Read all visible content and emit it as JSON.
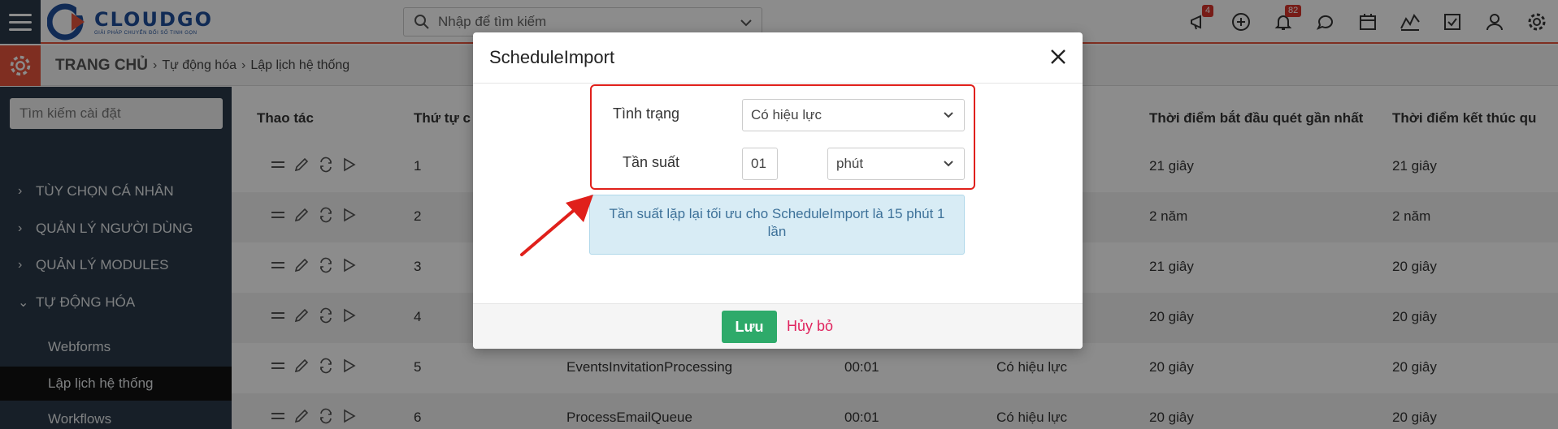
{
  "app": {
    "logo_name": "CLOUDGO",
    "logo_tagline": "GIẢI PHÁP CHUYỂN ĐỔI SỐ TINH GỌN",
    "search_placeholder": "Nhập để tìm kiếm",
    "badges": {
      "announce": "4",
      "notifications": "82"
    }
  },
  "breadcrumb": {
    "home": "TRANG CHỦ",
    "level1": "Tự động hóa",
    "level2": "Lập lịch hệ thống"
  },
  "sidebar": {
    "search_placeholder": "Tìm kiếm cài đặt",
    "groups": [
      {
        "label": "TÙY CHỌN CÁ NHÂN"
      },
      {
        "label": "QUẢN LÝ NGƯỜI DÙNG"
      },
      {
        "label": "QUẢN LÝ MODULES"
      },
      {
        "label": "TỰ ĐỘNG HÓA"
      }
    ],
    "subitems": [
      {
        "label": "Webforms"
      },
      {
        "label": "Lập lịch hệ thống"
      },
      {
        "label": "Workflows"
      }
    ]
  },
  "table": {
    "headers": {
      "actions": "Thao tác",
      "order": "Thứ tự c",
      "start": "Thời điểm bắt đầu quét gần nhất",
      "end": "Thời điểm kết thúc qu"
    },
    "rows": [
      {
        "order": "1",
        "name": "",
        "freq": "",
        "status": "",
        "start": "21 giây",
        "end": "21 giây"
      },
      {
        "order": "2",
        "name": "",
        "freq": "",
        "status": "",
        "start": "2 năm",
        "end": "2 năm"
      },
      {
        "order": "3",
        "name": "",
        "freq": "",
        "status": "",
        "start": "21 giây",
        "end": "20 giây"
      },
      {
        "order": "4",
        "name": "",
        "freq": "",
        "status": "",
        "start": "20 giây",
        "end": "20 giây"
      },
      {
        "order": "5",
        "name": "EventsInvitationProcessing",
        "freq": "00:01",
        "status": "Có hiệu lực",
        "start": "20 giây",
        "end": "20 giây"
      },
      {
        "order": "6",
        "name": "ProcessEmailQueue",
        "freq": "00:01",
        "status": "Có hiệu lực",
        "start": "20 giây",
        "end": "20 giây"
      }
    ]
  },
  "modal": {
    "title": "ScheduleImport",
    "status_label": "Tình trạng",
    "status_value": "Có hiệu lực",
    "freq_label": "Tần suất",
    "freq_value": "01",
    "freq_unit": "phút",
    "info": "Tần suất lặp lại tối ưu cho ScheduleImport là 15 phút 1 lần",
    "save_label": "Lưu",
    "cancel_label": "Hủy bỏ"
  },
  "colors": {
    "accent": "#e8553c",
    "sidebar_bg": "#2b3a4a",
    "save_green": "#2eaa6a",
    "highlight_red": "#e0201b"
  }
}
